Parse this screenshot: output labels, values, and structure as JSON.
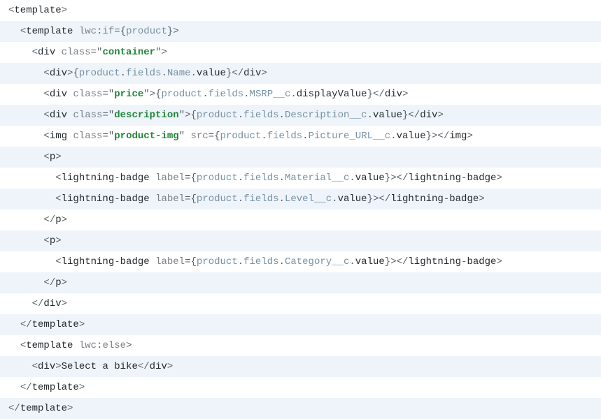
{
  "lines": [
    {
      "indent": 0,
      "parts": [
        {
          "cls": "punct",
          "t": "<"
        },
        {
          "cls": "tag",
          "t": "template"
        },
        {
          "cls": "punct",
          "t": ">"
        }
      ]
    },
    {
      "indent": 1,
      "parts": [
        {
          "cls": "punct",
          "t": "<"
        },
        {
          "cls": "tag",
          "t": "template "
        },
        {
          "cls": "attr",
          "t": "lwc"
        },
        {
          "cls": "punct",
          "t": ":"
        },
        {
          "cls": "attr",
          "t": "if"
        },
        {
          "cls": "punct",
          "t": "="
        },
        {
          "cls": "punct",
          "t": "{"
        },
        {
          "cls": "var",
          "t": "product"
        },
        {
          "cls": "punct",
          "t": "}"
        },
        {
          "cls": "punct",
          "t": ">"
        }
      ]
    },
    {
      "indent": 2,
      "parts": [
        {
          "cls": "punct",
          "t": "<"
        },
        {
          "cls": "tag",
          "t": "div "
        },
        {
          "cls": "attr",
          "t": "class"
        },
        {
          "cls": "punct",
          "t": "=\""
        },
        {
          "cls": "attrval",
          "t": "container"
        },
        {
          "cls": "punct",
          "t": "\">"
        }
      ]
    },
    {
      "indent": 3,
      "parts": [
        {
          "cls": "punct",
          "t": "<"
        },
        {
          "cls": "tag",
          "t": "div"
        },
        {
          "cls": "punct",
          "t": ">{"
        },
        {
          "cls": "var",
          "t": "product"
        },
        {
          "cls": "punct",
          "t": "."
        },
        {
          "cls": "var",
          "t": "fields"
        },
        {
          "cls": "punct",
          "t": "."
        },
        {
          "cls": "var",
          "t": "Name"
        },
        {
          "cls": "punct",
          "t": "."
        },
        {
          "cls": "black",
          "t": "value"
        },
        {
          "cls": "punct",
          "t": "}</"
        },
        {
          "cls": "tag",
          "t": "div"
        },
        {
          "cls": "punct",
          "t": ">"
        }
      ]
    },
    {
      "indent": 3,
      "parts": [
        {
          "cls": "punct",
          "t": "<"
        },
        {
          "cls": "tag",
          "t": "div "
        },
        {
          "cls": "attr",
          "t": "class"
        },
        {
          "cls": "punct",
          "t": "=\""
        },
        {
          "cls": "attrval",
          "t": "price"
        },
        {
          "cls": "punct",
          "t": "\">{"
        },
        {
          "cls": "var",
          "t": "product"
        },
        {
          "cls": "punct",
          "t": "."
        },
        {
          "cls": "var",
          "t": "fields"
        },
        {
          "cls": "punct",
          "t": "."
        },
        {
          "cls": "var",
          "t": "MSRP__c"
        },
        {
          "cls": "punct",
          "t": "."
        },
        {
          "cls": "black",
          "t": "displayValue"
        },
        {
          "cls": "punct",
          "t": "}</"
        },
        {
          "cls": "tag",
          "t": "div"
        },
        {
          "cls": "punct",
          "t": ">"
        }
      ]
    },
    {
      "indent": 3,
      "parts": [
        {
          "cls": "punct",
          "t": "<"
        },
        {
          "cls": "tag",
          "t": "div "
        },
        {
          "cls": "attr",
          "t": "class"
        },
        {
          "cls": "punct",
          "t": "=\""
        },
        {
          "cls": "attrval",
          "t": "description"
        },
        {
          "cls": "punct",
          "t": "\">{"
        },
        {
          "cls": "var",
          "t": "product"
        },
        {
          "cls": "punct",
          "t": "."
        },
        {
          "cls": "var",
          "t": "fields"
        },
        {
          "cls": "punct",
          "t": "."
        },
        {
          "cls": "var",
          "t": "Description__c"
        },
        {
          "cls": "punct",
          "t": "."
        },
        {
          "cls": "black",
          "t": "value"
        },
        {
          "cls": "punct",
          "t": "}</"
        },
        {
          "cls": "tag",
          "t": "div"
        },
        {
          "cls": "punct",
          "t": ">"
        }
      ]
    },
    {
      "indent": 3,
      "parts": [
        {
          "cls": "punct",
          "t": "<"
        },
        {
          "cls": "tag",
          "t": "img "
        },
        {
          "cls": "attr",
          "t": "class"
        },
        {
          "cls": "punct",
          "t": "=\""
        },
        {
          "cls": "attrval",
          "t": "product-img"
        },
        {
          "cls": "punct",
          "t": "\" "
        },
        {
          "cls": "attr",
          "t": "src"
        },
        {
          "cls": "punct",
          "t": "={"
        },
        {
          "cls": "var",
          "t": "product"
        },
        {
          "cls": "punct",
          "t": "."
        },
        {
          "cls": "var",
          "t": "fields"
        },
        {
          "cls": "punct",
          "t": "."
        },
        {
          "cls": "var",
          "t": "Picture_URL__c"
        },
        {
          "cls": "punct",
          "t": "."
        },
        {
          "cls": "black",
          "t": "value"
        },
        {
          "cls": "punct",
          "t": "}></"
        },
        {
          "cls": "tag",
          "t": "img"
        },
        {
          "cls": "punct",
          "t": ">"
        }
      ]
    },
    {
      "indent": 3,
      "parts": [
        {
          "cls": "punct",
          "t": "<"
        },
        {
          "cls": "tag",
          "t": "p"
        },
        {
          "cls": "punct",
          "t": ">"
        }
      ]
    },
    {
      "indent": 4,
      "parts": [
        {
          "cls": "punct",
          "t": "<"
        },
        {
          "cls": "tag",
          "t": "lightning"
        },
        {
          "cls": "punct",
          "t": "-"
        },
        {
          "cls": "tag",
          "t": "badge "
        },
        {
          "cls": "attr",
          "t": "label"
        },
        {
          "cls": "punct",
          "t": "={"
        },
        {
          "cls": "var",
          "t": "product"
        },
        {
          "cls": "punct",
          "t": "."
        },
        {
          "cls": "var",
          "t": "fields"
        },
        {
          "cls": "punct",
          "t": "."
        },
        {
          "cls": "var",
          "t": "Material__c"
        },
        {
          "cls": "punct",
          "t": "."
        },
        {
          "cls": "black",
          "t": "value"
        },
        {
          "cls": "punct",
          "t": "}></"
        },
        {
          "cls": "tag",
          "t": "lightning"
        },
        {
          "cls": "punct",
          "t": "-"
        },
        {
          "cls": "tag",
          "t": "badge"
        },
        {
          "cls": "punct",
          "t": ">"
        }
      ]
    },
    {
      "indent": 4,
      "parts": [
        {
          "cls": "punct",
          "t": "<"
        },
        {
          "cls": "tag",
          "t": "lightning"
        },
        {
          "cls": "punct",
          "t": "-"
        },
        {
          "cls": "tag",
          "t": "badge "
        },
        {
          "cls": "attr",
          "t": "label"
        },
        {
          "cls": "punct",
          "t": "={"
        },
        {
          "cls": "var",
          "t": "product"
        },
        {
          "cls": "punct",
          "t": "."
        },
        {
          "cls": "var",
          "t": "fields"
        },
        {
          "cls": "punct",
          "t": "."
        },
        {
          "cls": "var",
          "t": "Level__c"
        },
        {
          "cls": "punct",
          "t": "."
        },
        {
          "cls": "black",
          "t": "value"
        },
        {
          "cls": "punct",
          "t": "}></"
        },
        {
          "cls": "tag",
          "t": "lightning"
        },
        {
          "cls": "punct",
          "t": "-"
        },
        {
          "cls": "tag",
          "t": "badge"
        },
        {
          "cls": "punct",
          "t": ">"
        }
      ]
    },
    {
      "indent": 3,
      "parts": [
        {
          "cls": "punct",
          "t": "</"
        },
        {
          "cls": "tag",
          "t": "p"
        },
        {
          "cls": "punct",
          "t": ">"
        }
      ]
    },
    {
      "indent": 3,
      "parts": [
        {
          "cls": "punct",
          "t": "<"
        },
        {
          "cls": "tag",
          "t": "p"
        },
        {
          "cls": "punct",
          "t": ">"
        }
      ]
    },
    {
      "indent": 4,
      "parts": [
        {
          "cls": "punct",
          "t": "<"
        },
        {
          "cls": "tag",
          "t": "lightning"
        },
        {
          "cls": "punct",
          "t": "-"
        },
        {
          "cls": "tag",
          "t": "badge "
        },
        {
          "cls": "attr",
          "t": "label"
        },
        {
          "cls": "punct",
          "t": "={"
        },
        {
          "cls": "var",
          "t": "product"
        },
        {
          "cls": "punct",
          "t": "."
        },
        {
          "cls": "var",
          "t": "fields"
        },
        {
          "cls": "punct",
          "t": "."
        },
        {
          "cls": "var",
          "t": "Category__c"
        },
        {
          "cls": "punct",
          "t": "."
        },
        {
          "cls": "black",
          "t": "value"
        },
        {
          "cls": "punct",
          "t": "}></"
        },
        {
          "cls": "tag",
          "t": "lightning"
        },
        {
          "cls": "punct",
          "t": "-"
        },
        {
          "cls": "tag",
          "t": "badge"
        },
        {
          "cls": "punct",
          "t": ">"
        }
      ]
    },
    {
      "indent": 3,
      "parts": [
        {
          "cls": "punct",
          "t": "</"
        },
        {
          "cls": "tag",
          "t": "p"
        },
        {
          "cls": "punct",
          "t": ">"
        }
      ]
    },
    {
      "indent": 2,
      "parts": [
        {
          "cls": "punct",
          "t": "</"
        },
        {
          "cls": "tag",
          "t": "div"
        },
        {
          "cls": "punct",
          "t": ">"
        }
      ]
    },
    {
      "indent": 1,
      "parts": [
        {
          "cls": "punct",
          "t": "</"
        },
        {
          "cls": "tag",
          "t": "template"
        },
        {
          "cls": "punct",
          "t": ">"
        }
      ]
    },
    {
      "indent": 1,
      "parts": [
        {
          "cls": "punct",
          "t": "<"
        },
        {
          "cls": "tag",
          "t": "template "
        },
        {
          "cls": "attr",
          "t": "lwc"
        },
        {
          "cls": "punct",
          "t": ":"
        },
        {
          "cls": "attr",
          "t": "else"
        },
        {
          "cls": "punct",
          "t": ">"
        }
      ]
    },
    {
      "indent": 2,
      "parts": [
        {
          "cls": "punct",
          "t": "<"
        },
        {
          "cls": "tag",
          "t": "div"
        },
        {
          "cls": "punct",
          "t": ">"
        },
        {
          "cls": "black",
          "t": "Select a bike"
        },
        {
          "cls": "punct",
          "t": "</"
        },
        {
          "cls": "tag",
          "t": "div"
        },
        {
          "cls": "punct",
          "t": ">"
        }
      ]
    },
    {
      "indent": 1,
      "parts": [
        {
          "cls": "punct",
          "t": "</"
        },
        {
          "cls": "tag",
          "t": "template"
        },
        {
          "cls": "punct",
          "t": ">"
        }
      ]
    },
    {
      "indent": 0,
      "parts": [
        {
          "cls": "punct",
          "t": "</"
        },
        {
          "cls": "tag",
          "t": "template"
        },
        {
          "cls": "punct",
          "t": ">"
        }
      ]
    }
  ]
}
